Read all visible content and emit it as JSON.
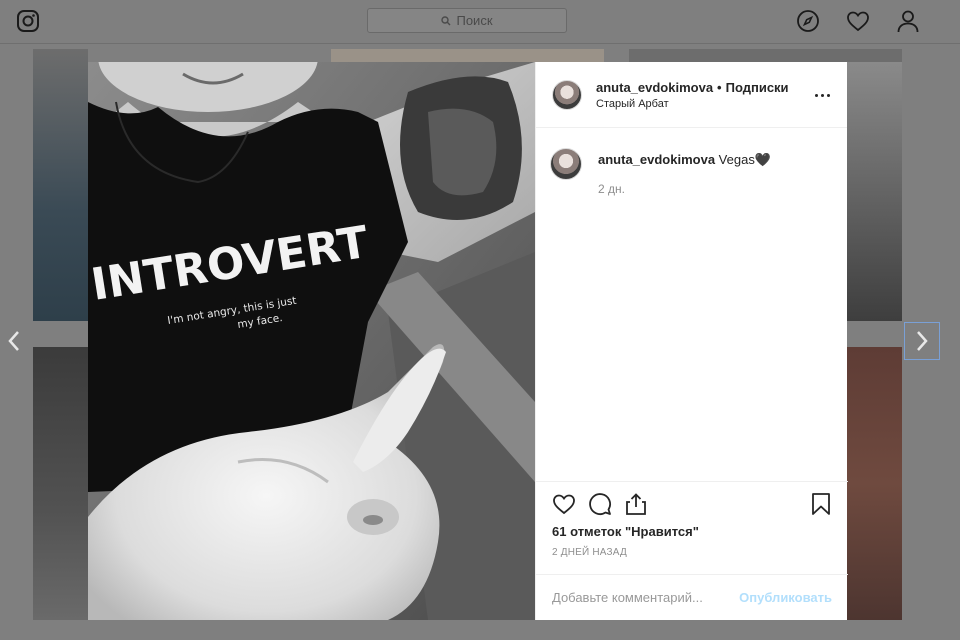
{
  "search": {
    "placeholder": "Поиск"
  },
  "post": {
    "username": "anuta_evdokimova",
    "separator": "•",
    "follow_label": "Подписки",
    "location": "Старый Арбат",
    "caption": "Vegas🖤",
    "comment_time": "2 дн.",
    "likes_text": "61 отметок \"Нравится\"",
    "date_text": "2 ДНЕЙ НАЗАД",
    "comment_placeholder": "Добавьте комментарий...",
    "publish_label": "Опубликовать"
  },
  "photo": {
    "shirt_text": "INTROVERT",
    "shirt_subtext_1": "I'm not angry, this is just",
    "shirt_subtext_2": "my face."
  }
}
